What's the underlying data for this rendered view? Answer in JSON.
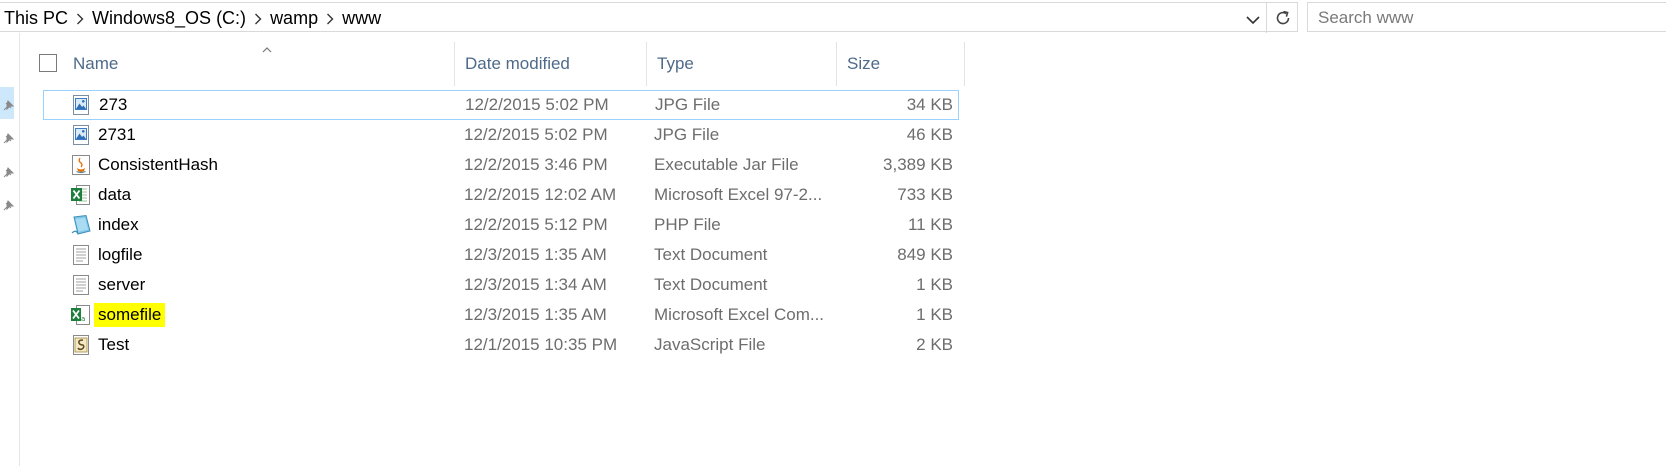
{
  "address": {
    "crumbs": [
      "This PC",
      "Windows8_OS (C:)",
      "wamp",
      "www"
    ],
    "dropdown_icon": "chevron-down-icon",
    "refresh_icon": "refresh-icon"
  },
  "search": {
    "placeholder": "Search www"
  },
  "columns": {
    "name": "Name",
    "date": "Date modified",
    "type": "Type",
    "size": "Size"
  },
  "files": [
    {
      "name": "273",
      "date": "12/2/2015 5:02 PM",
      "type": "JPG File",
      "size": "34 KB",
      "icon": "image-file-icon"
    },
    {
      "name": "2731",
      "date": "12/2/2015 5:02 PM",
      "type": "JPG File",
      "size": "46 KB",
      "icon": "image-file-icon"
    },
    {
      "name": "ConsistentHash",
      "date": "12/2/2015 3:46 PM",
      "type": "Executable Jar File",
      "size": "3,389 KB",
      "icon": "java-jar-icon"
    },
    {
      "name": "data",
      "date": "12/2/2015 12:02 AM",
      "type": "Microsoft Excel 97-2...",
      "size": "733 KB",
      "icon": "excel-file-icon"
    },
    {
      "name": "index",
      "date": "12/2/2015 5:12 PM",
      "type": "PHP File",
      "size": "11 KB",
      "icon": "php-file-icon"
    },
    {
      "name": "logfile",
      "date": "12/3/2015 1:35 AM",
      "type": "Text Document",
      "size": "849 KB",
      "icon": "text-file-icon"
    },
    {
      "name": "server",
      "date": "12/3/2015 1:34 AM",
      "type": "Text Document",
      "size": "1 KB",
      "icon": "text-file-icon"
    },
    {
      "name": "somefile",
      "date": "12/3/2015 1:35 AM",
      "type": "Microsoft Excel Com...",
      "size": "1 KB",
      "icon": "excel-csv-icon"
    },
    {
      "name": "Test",
      "date": "12/1/2015 10:35 PM",
      "type": "JavaScript File",
      "size": "2 KB",
      "icon": "javascript-file-icon"
    }
  ],
  "colors": {
    "header_text": "#4d6a8a",
    "focus_border": "#99d1ff",
    "highlight": "#ffff00",
    "nav_selected": "#cde8fb"
  }
}
